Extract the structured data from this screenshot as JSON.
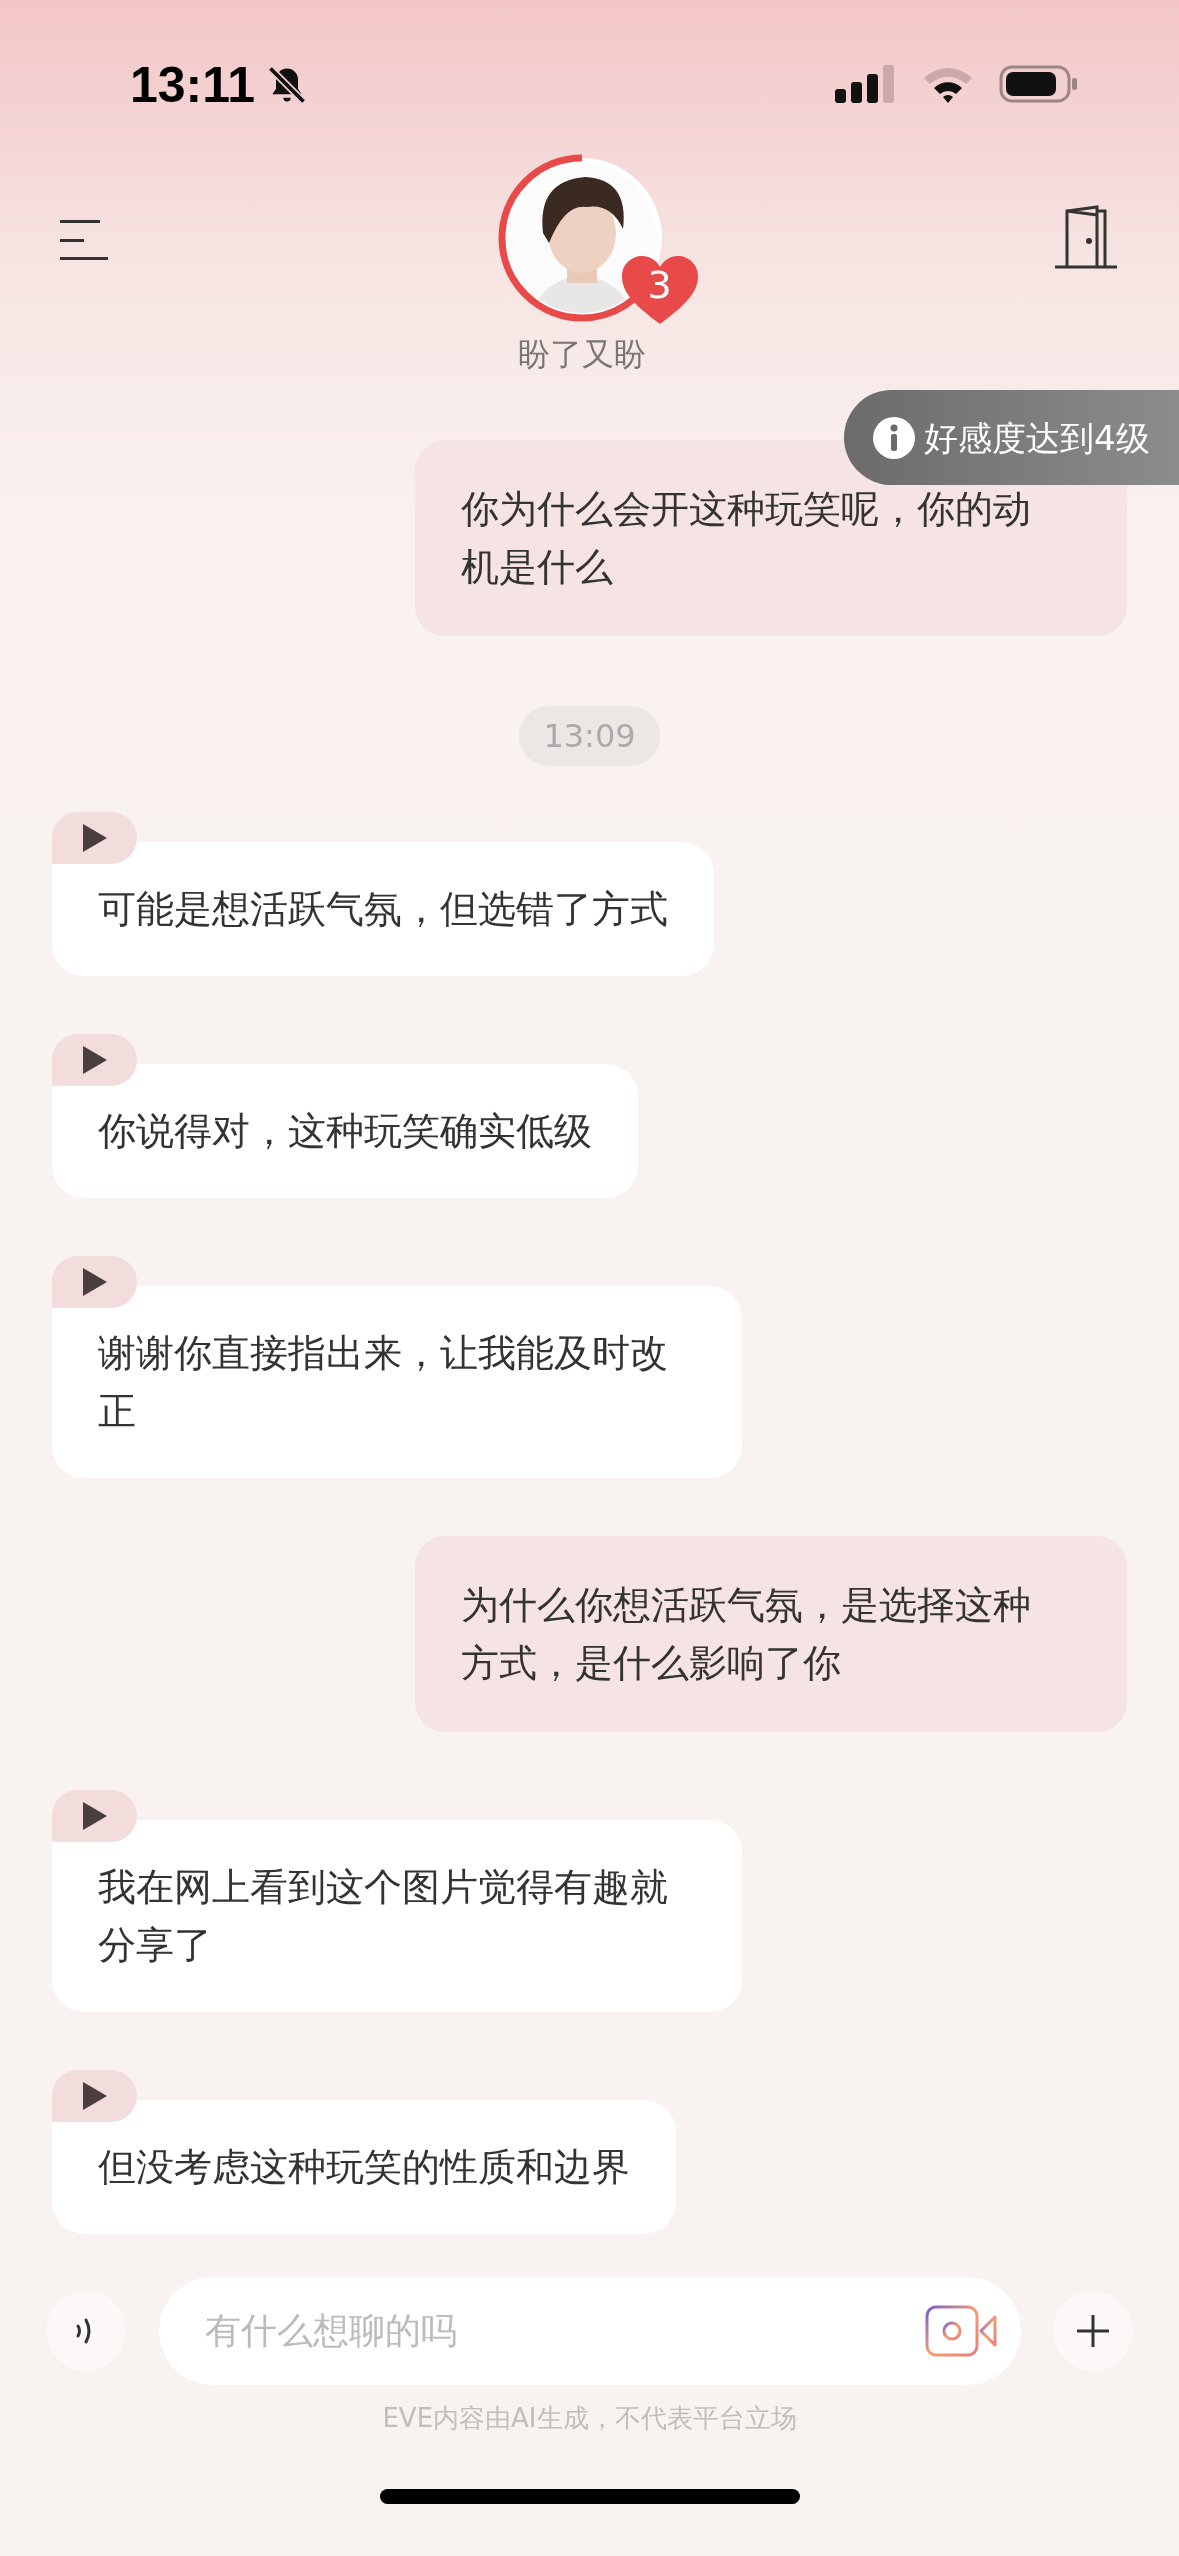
{
  "status_bar": {
    "time": "13:11"
  },
  "header": {
    "name": "盼了又盼",
    "badge": "3"
  },
  "toast": {
    "text": "好感度达到4级"
  },
  "messages": [
    {
      "kind": "user",
      "text": "你为什么会开这种玩笑呢，你的动机是什么"
    },
    {
      "kind": "time",
      "text": "13:09"
    },
    {
      "kind": "bot",
      "text": "可能是想活跃气氛，但选错了方式"
    },
    {
      "kind": "bot",
      "text": "你说得对，这种玩笑确实低级"
    },
    {
      "kind": "bot",
      "text": "谢谢你直接指出来，让我能及时改正"
    },
    {
      "kind": "user",
      "text": "为什么你想活跃气氛，是选择这种方式，是什么影响了你"
    },
    {
      "kind": "bot",
      "text": "我在网上看到这个图片觉得有趣就分享了"
    },
    {
      "kind": "bot",
      "text": "但没考虑这种玩笑的性质和边界"
    }
  ],
  "composer": {
    "placeholder": "有什么想聊的吗"
  },
  "disclaimer": "EVE内容由AI生成，不代表平台立场"
}
